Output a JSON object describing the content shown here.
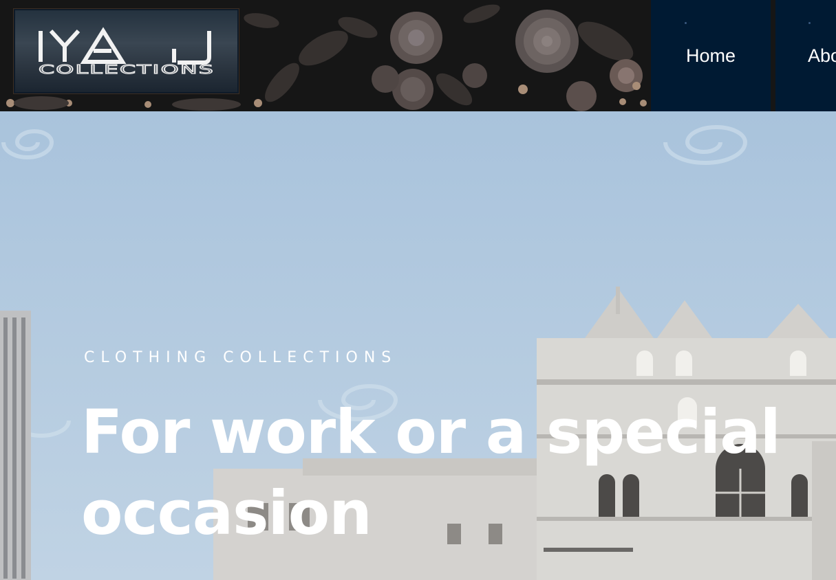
{
  "brand": {
    "logo_primary": "IYA J",
    "logo_secondary": "COLLECTIONS"
  },
  "nav": {
    "items": [
      {
        "label": "Home"
      },
      {
        "label": "Abo"
      }
    ]
  },
  "hero": {
    "eyebrow": "CLOTHING COLLECTIONS",
    "headline": "For work or a special occasion"
  },
  "colors": {
    "nav_bg": "#001a33",
    "header_bg": "#141414",
    "sky": "#b6cde2",
    "text": "#ffffff"
  }
}
